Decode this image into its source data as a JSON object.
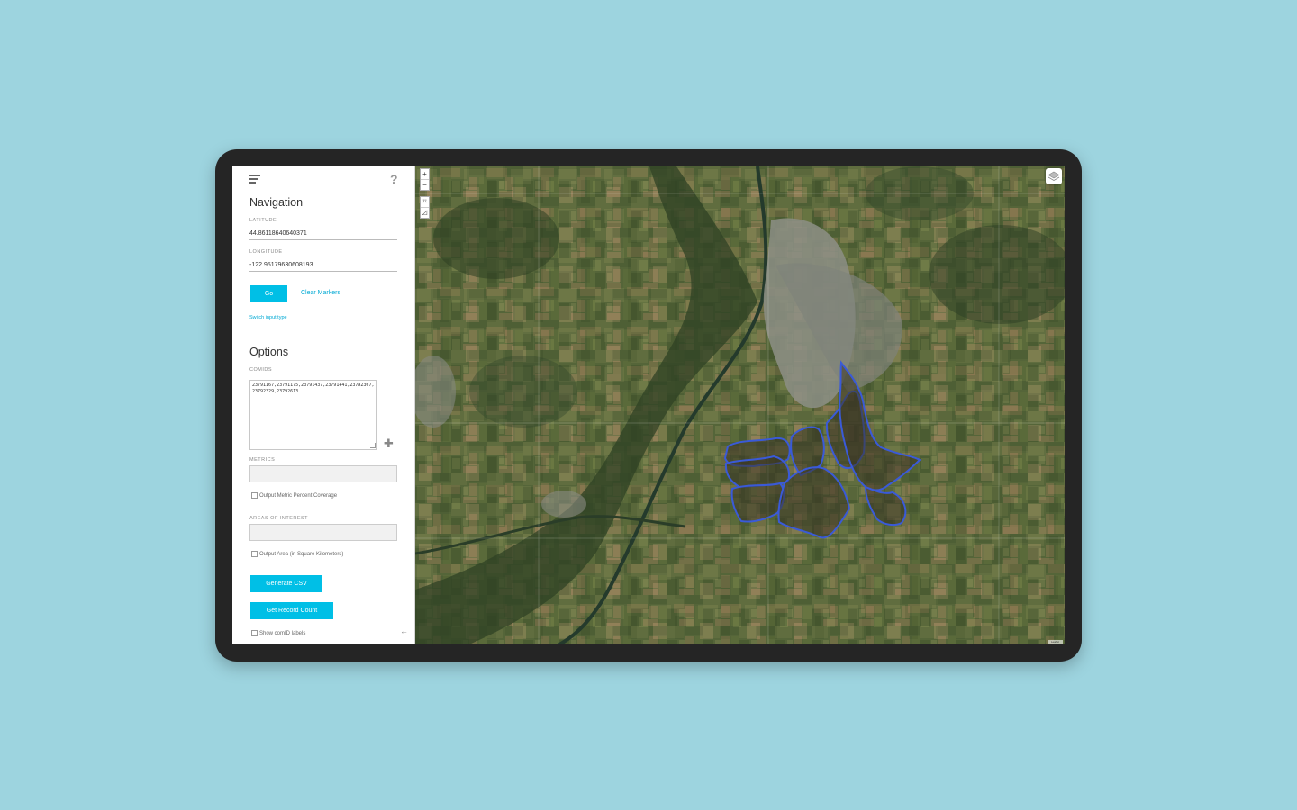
{
  "sidebar": {
    "navigation": {
      "title": "Navigation",
      "latitude_label": "LATITUDE",
      "latitude_value": "44.86118640640371",
      "longitude_label": "LONGITUDE",
      "longitude_value": "-122.95179630608193",
      "go_label": "Go",
      "clear_markers_label": "Clear Markers",
      "switch_input_label": "Switch input type"
    },
    "options": {
      "title": "Options",
      "comids_label": "COMIDS",
      "comids_value": "23791167,23791175,23791437,23791441,23792307,23792329,23792613",
      "metrics_label": "METRICS",
      "metric_percent_label": "Output Metric Percent Coverage",
      "areas_label": "AREAS OF INTEREST",
      "area_output_label": "Output Area (in Square Kilometers)",
      "generate_csv_label": "Generate CSV",
      "record_count_label": "Get Record Count",
      "show_labels_label": "Show comID labels"
    }
  },
  "map": {
    "zoom_in": "+",
    "zoom_out": "−",
    "boundary_color": "#3a5ad8",
    "attribution": "Leaflet"
  },
  "colors": {
    "accent": "#00bfe6",
    "background": "#9dd4df",
    "device": "#252525"
  }
}
